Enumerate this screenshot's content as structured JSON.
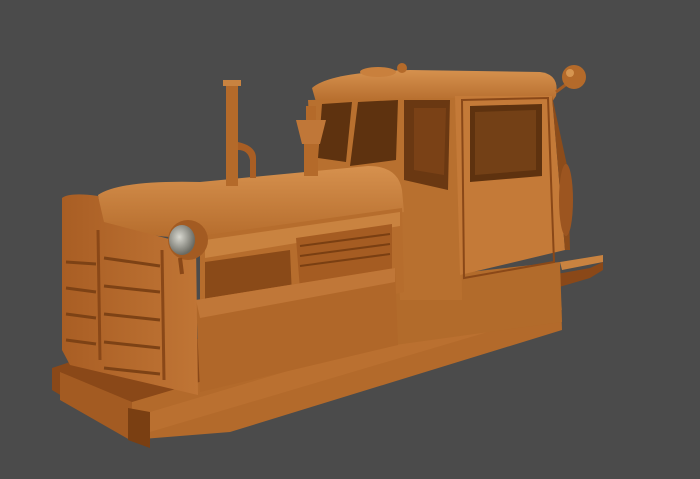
{
  "viewport": {
    "background_color": "#4b4b4b"
  },
  "model": {
    "subject": "tractor-locomotive",
    "material_color": "#b46a2a",
    "highlight_color": "#cf8a45",
    "shadow_color": "#7a4316",
    "dark_color": "#5a300c"
  }
}
